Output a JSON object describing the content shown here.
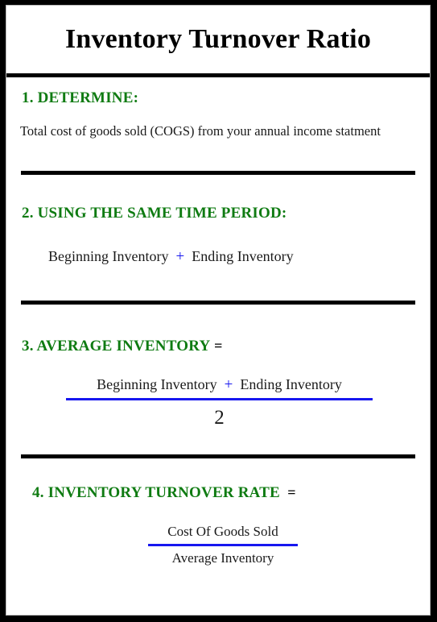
{
  "document": {
    "title": "Inventory Turnover Ratio",
    "accent_green": "#0f7b12",
    "accent_blue": "#1717ef",
    "text_color": "#1a1a1a",
    "frame_color": "#000000"
  },
  "sections": [
    {
      "id": "determine",
      "number": "1.",
      "heading": "1. DETERMINE:",
      "body": "Total cost of goods sold (COGS) from your annual income statment"
    },
    {
      "id": "same-time-period",
      "number": "2.",
      "heading": "2. USING THE SAME TIME PERIOD:",
      "expression": {
        "left": "Beginning Inventory",
        "operator": "+",
        "right": "Ending Inventory"
      }
    },
    {
      "id": "average-inventory",
      "number": "3.",
      "heading": "3. AVERAGE INVENTORY",
      "equals": "=",
      "fraction": {
        "numerator_left": "Beginning Inventory",
        "numerator_operator": "+",
        "numerator_right": "Ending Inventory",
        "denominator": "2"
      }
    },
    {
      "id": "inventory-turnover-rate",
      "number": "4.",
      "heading": "4. INVENTORY TURNOVER RATE",
      "equals": "=",
      "fraction": {
        "numerator": "Cost Of Goods Sold",
        "denominator": "Average Inventory"
      }
    }
  ]
}
